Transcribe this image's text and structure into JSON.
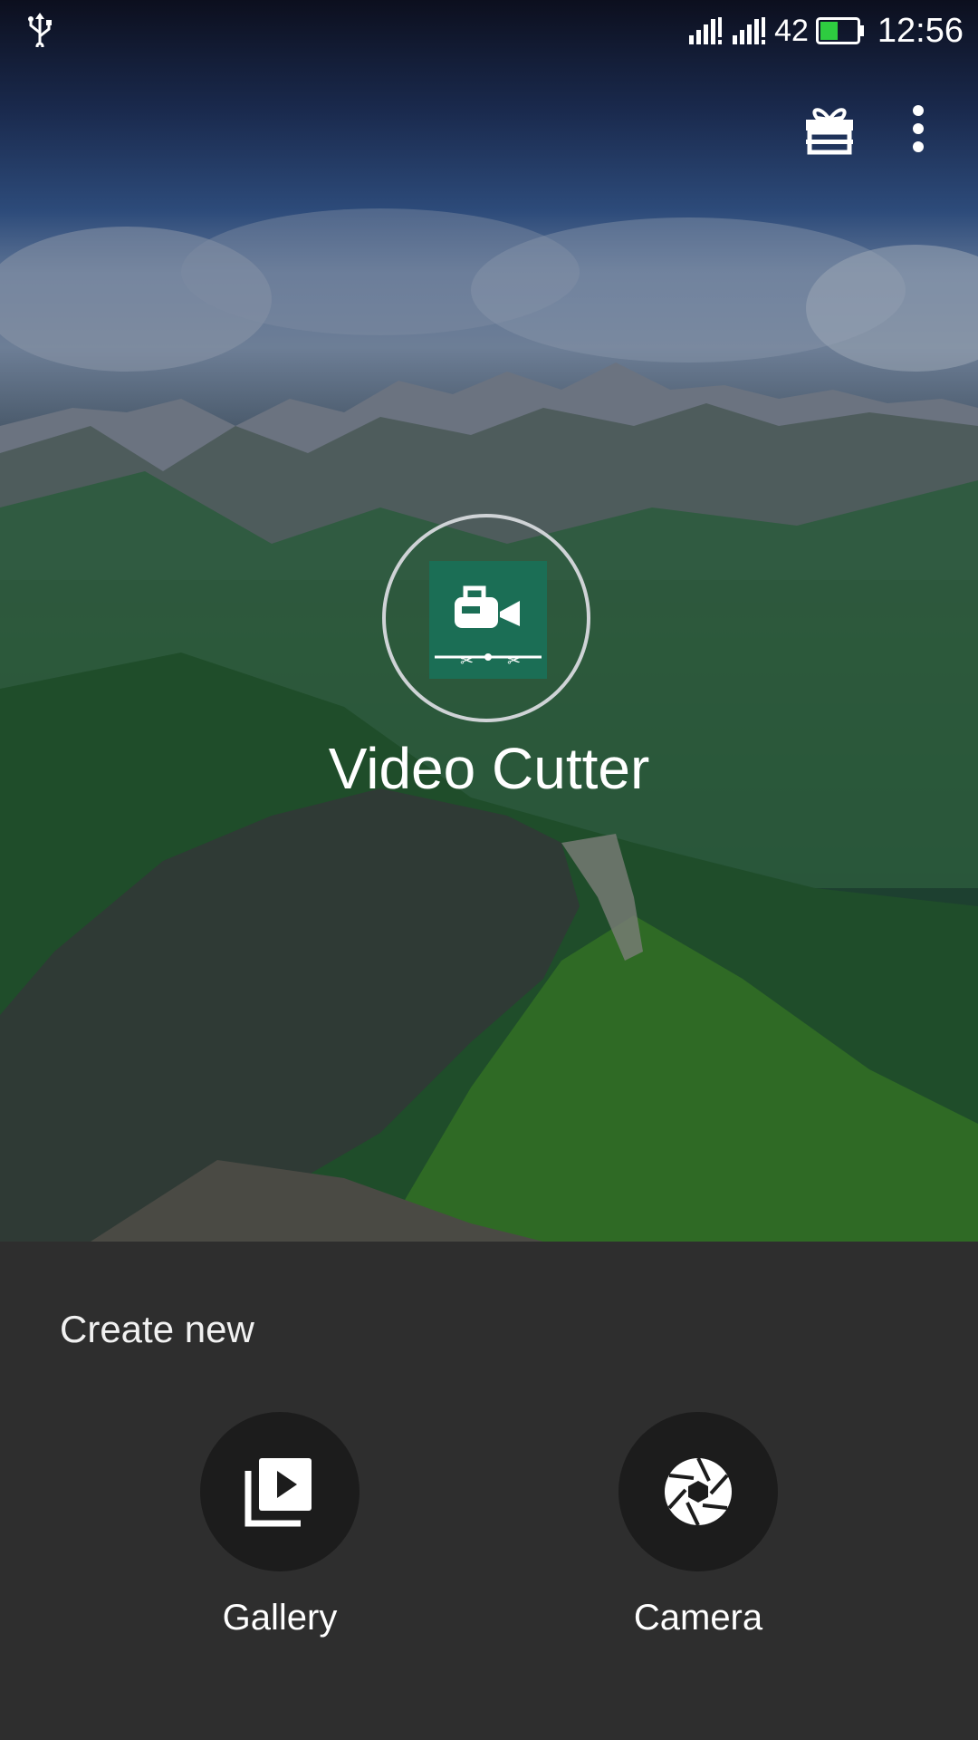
{
  "status_bar": {
    "usb_icon": "usb-icon",
    "signal_icons": [
      "signal-icon-sim1",
      "signal-icon-sim2"
    ],
    "battery_level": "42",
    "time": "12:56",
    "battery_color": "#2ecc40"
  },
  "top_bar": {
    "icons": [
      "gift-icon",
      "more-vert-icon"
    ]
  },
  "hero": {
    "app_logo_icon": "video-cutter-logo-icon",
    "app_title": "Video Cutter",
    "logo_color": "#1b6e55"
  },
  "sheet": {
    "heading": "Create new",
    "actions": [
      {
        "label": "Gallery",
        "icon": "video-library-icon"
      },
      {
        "label": "Camera",
        "icon": "camera-shutter-icon"
      }
    ]
  }
}
